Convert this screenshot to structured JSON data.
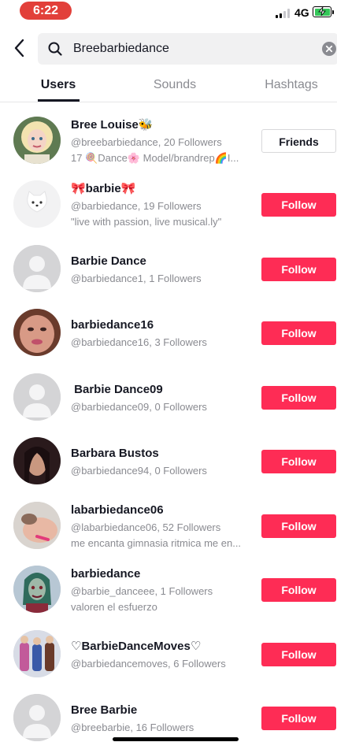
{
  "status": {
    "time": "6:22",
    "network": "4G"
  },
  "search": {
    "query": "Breebarbiedance"
  },
  "tabs": [
    {
      "label": "Users",
      "active": true
    },
    {
      "label": "Sounds",
      "active": false
    },
    {
      "label": "Hashtags",
      "active": false
    }
  ],
  "users": [
    {
      "name": "Bree Louise🐝",
      "handle": "@breebarbiedance, 20 Followers",
      "bio": "17 🍭Dance🌸 Model/brandrep🌈I...",
      "button": "Friends",
      "avatar": "photo-blonde"
    },
    {
      "name": "🎀barbie🎀",
      "handle": "@barbiedance, 19 Followers",
      "bio": "\"live with passion, live musical.ly\"",
      "button": "Follow",
      "avatar": "cat"
    },
    {
      "name": "Barbie Dance",
      "handle": "@barbiedance1, 1 Followers",
      "bio": "",
      "button": "Follow",
      "avatar": "default"
    },
    {
      "name": "barbiedance16",
      "handle": "@barbiedance16, 3 Followers",
      "bio": "",
      "button": "Follow",
      "avatar": "photo-face"
    },
    {
      "name": " Barbie Dance09",
      "handle": "@barbiedance09, 0 Followers",
      "bio": "",
      "button": "Follow",
      "avatar": "default"
    },
    {
      "name": "Barbara Bustos",
      "handle": "@barbiedance94, 0 Followers",
      "bio": "",
      "button": "Follow",
      "avatar": "photo-dark"
    },
    {
      "name": "labarbiedance06",
      "handle": "@labarbiedance06, 52 Followers",
      "bio": "me encanta gimnasia ritmica me en...",
      "button": "Follow",
      "avatar": "photo-hand"
    },
    {
      "name": "barbiedance",
      "handle": "@barbie_danceee, 1 Followers",
      "bio": "valoren el esfuerzo",
      "button": "Follow",
      "avatar": "photo-doll"
    },
    {
      "name": "♡BarbieDanceMoves♡",
      "handle": "@barbiedancemoves, 6 Followers",
      "bio": "",
      "button": "Follow",
      "avatar": "photo-dolls"
    },
    {
      "name": "Bree Barbie",
      "handle": "@breebarbie, 16 Followers",
      "bio": "",
      "button": "Follow",
      "avatar": "default"
    }
  ],
  "colors": {
    "accent": "#fe2c55",
    "status_pill": "#e2403a"
  }
}
